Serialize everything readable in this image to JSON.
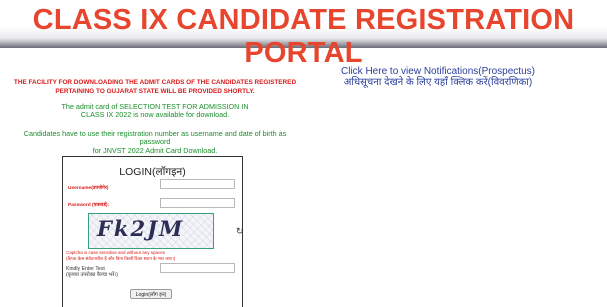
{
  "header": {
    "title": "CLASS IX CANDIDATE REGISTRATION PORTAL"
  },
  "notices": {
    "red": "THE FACILITY FOR DOWNLOADING THE ADMIT CARDS OF THE CANDIDATES REGISTERED PERTAINING TO GUJARAT STATE WILL BE PROVIDED SHORTLY.",
    "green_line1": "The admit card of SELECTION TEST FOR ADMISSION IN",
    "green_line2": "CLASS IX 2022 is now available for download.",
    "green_line3": "Candidates have to use their registration number as username and date of birth as",
    "green_line4": "password",
    "green_line5": "for JNVST 2022 Admit Card Download."
  },
  "notifications": {
    "link_en": "Click Here to view Notifications(Prospectus)",
    "link_hi": "अधिसूचना देखने के लिए यहाँ क्लिक करें(विवरणिका)"
  },
  "login": {
    "title": "LOGIN(लॉगइन)",
    "username_label": "Username(उपयोगेर)",
    "username_value": "",
    "password_label": "Password (पासवर्ड):",
    "password_value": "",
    "captcha_text": "Fk2JM",
    "captcha_hint_en": "Captcha is case sensitive and without any spaces",
    "captcha_hint_hi": "(कैप्चा केस संवेदनशील है और बिना किसी रिक्त स्थान के भरा जाए।)",
    "enter_text_label": "Kindly Enter Text",
    "enter_text_label_hi": "(कृपया उपरोक्त कैप्चा भरें।)",
    "enter_text_value": "",
    "button_label": "Login(लॉग इन)"
  },
  "colors": {
    "title": "#e8452f",
    "notice_red": "#d81b1b",
    "notice_green": "#1a8f2c",
    "link_blue": "#2a3f9b"
  },
  "icons": {
    "refresh": "refresh-icon"
  }
}
